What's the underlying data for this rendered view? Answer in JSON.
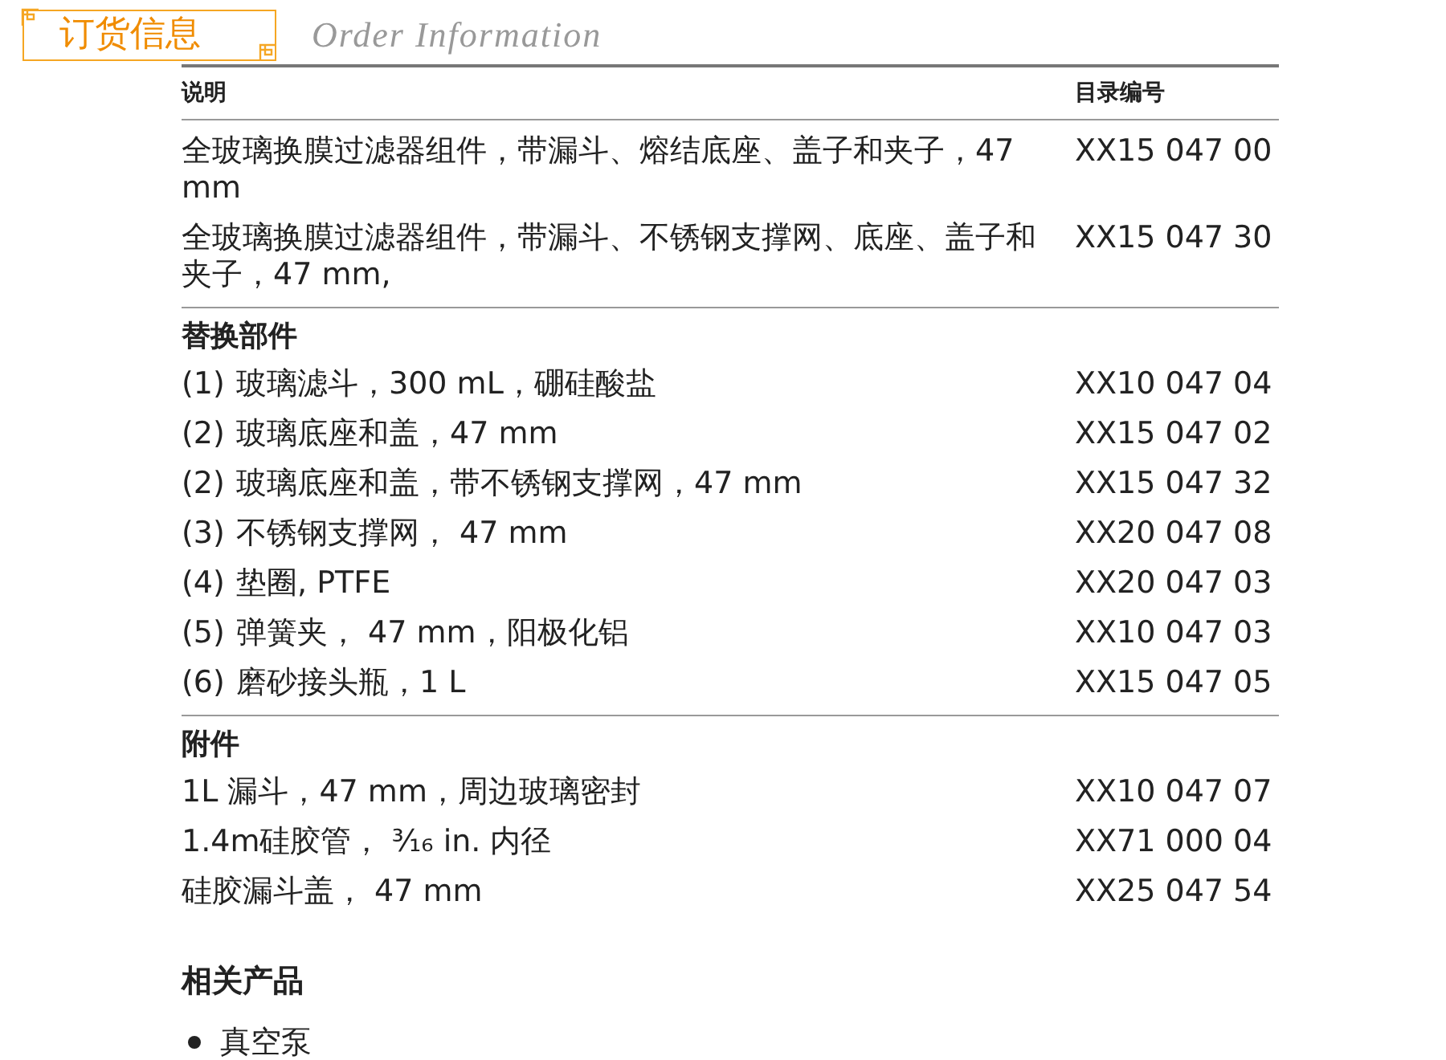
{
  "header": {
    "title": "订货信息",
    "subtitle": "Order Information"
  },
  "table": {
    "columns": [
      "说明",
      "目录编号"
    ],
    "sections": [
      {
        "rows": [
          {
            "description": "全玻璃换膜过滤器组件，带漏斗、熔结底座、盖子和夹子，47 mm",
            "catalog_number": "XX15 047 00"
          },
          {
            "description": "全玻璃换膜过滤器组件，带漏斗、不锈钢支撑网、底座、盖子和夹子，47 mm,",
            "catalog_number": "XX15 047 30"
          }
        ]
      },
      {
        "heading": "替换部件",
        "rows": [
          {
            "index": "(1)",
            "description": "玻璃滤斗，300 mL，硼硅酸盐",
            "catalog_number": "XX10 047 04"
          },
          {
            "index": "(2)",
            "description": "玻璃底座和盖，47 mm",
            "catalog_number": "XX15 047 02"
          },
          {
            "index": "(2)",
            "description": "玻璃底座和盖，带不锈钢支撑网，47 mm",
            "catalog_number": "XX15 047 32"
          },
          {
            "index": "(3)",
            "description": "不锈钢支撑网， 47 mm",
            "catalog_number": "XX20 047 08"
          },
          {
            "index": "(4)",
            "description": "垫圈, PTFE",
            "catalog_number": "XX20 047 03"
          },
          {
            "index": "(5)",
            "description": "弹簧夹， 47 mm，阳极化铝",
            "catalog_number": "XX10 047 03"
          },
          {
            "index": "(6)",
            "description": "磨砂接头瓶，1 L",
            "catalog_number": "XX15 047 05"
          }
        ]
      },
      {
        "heading": "附件",
        "rows": [
          {
            "description": "1L 漏斗，47 mm，周边玻璃密封",
            "catalog_number": "XX10 047 07"
          },
          {
            "description": "1.4m硅胶管， ³⁄₁₆ in. 内径",
            "catalog_number": "XX71 000 04"
          },
          {
            "description": "硅胶漏斗盖， 47 mm",
            "catalog_number": "XX25 047 54"
          }
        ]
      }
    ]
  },
  "related": {
    "heading": "相关产品",
    "items": [
      "真空泵"
    ]
  }
}
